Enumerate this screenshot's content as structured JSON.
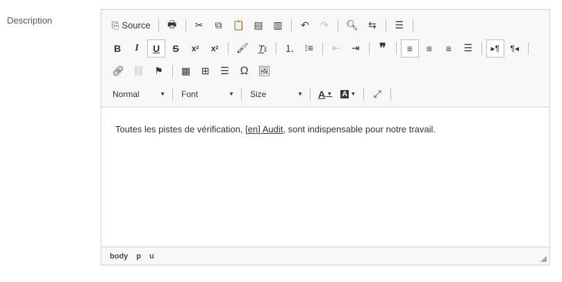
{
  "field_label": "Description",
  "toolbar": {
    "source_label": "Source",
    "format_value": "Normal",
    "font_value": "Font",
    "size_value": "Size"
  },
  "content": {
    "before": "Toutes les pistes de vérification, ",
    "link": "[en] Audit",
    "after": ", sont indispensable pour notre travail."
  },
  "path": [
    "body",
    "p",
    "u"
  ]
}
